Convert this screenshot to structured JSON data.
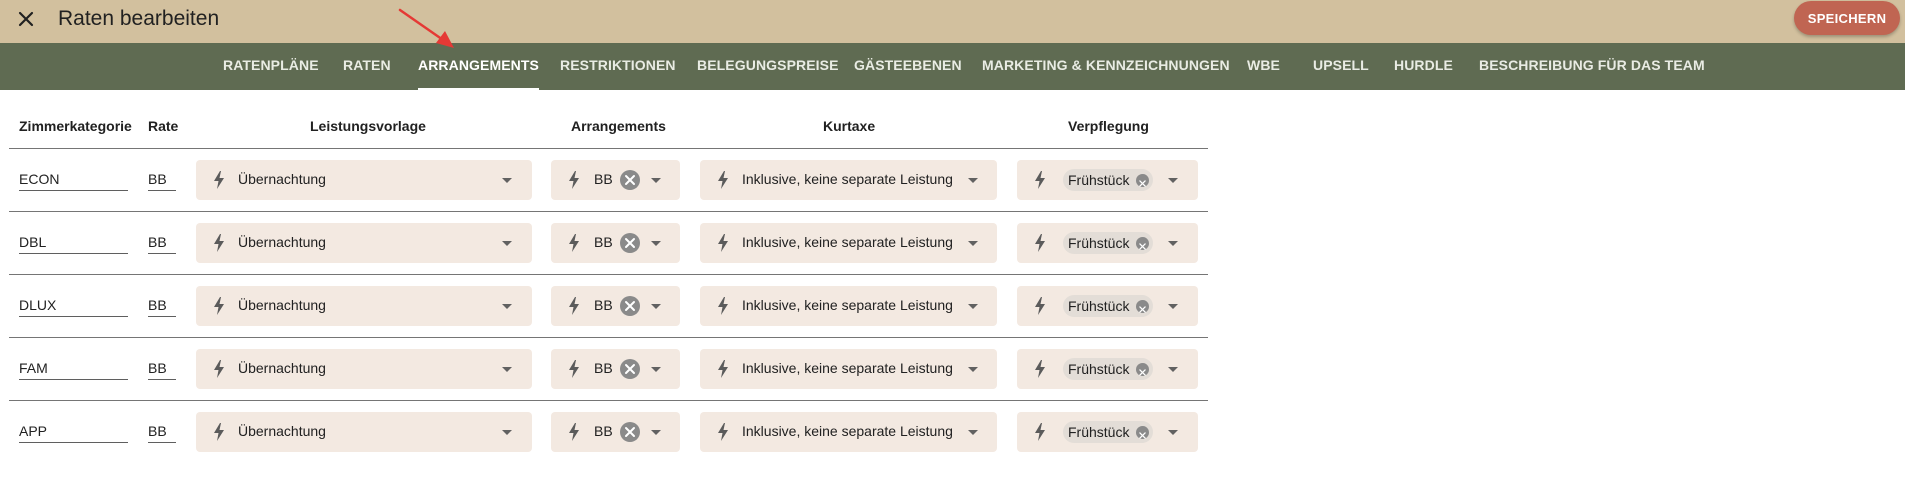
{
  "header": {
    "title": "Raten bearbeiten",
    "save_label": "SPEICHERN"
  },
  "tabs": [
    {
      "label": "RATENPLÄNE",
      "active": false
    },
    {
      "label": "RATEN",
      "active": false
    },
    {
      "label": "ARRANGEMENTS",
      "active": true
    },
    {
      "label": "RESTRIKTIONEN",
      "active": false
    },
    {
      "label": "BELEGUNGSPREISE",
      "active": false
    },
    {
      "label": "GÄSTEEBENEN",
      "active": false
    },
    {
      "label": "MARKETING & KENNZEICHNUNGEN",
      "active": false
    },
    {
      "label": "WBE",
      "active": false
    },
    {
      "label": "UPSELL",
      "active": false
    },
    {
      "label": "HURDLE",
      "active": false
    },
    {
      "label": "BESCHREIBUNG FÜR DAS TEAM",
      "active": false
    }
  ],
  "columns": {
    "room_category": "Zimmerkategorie",
    "rate": "Rate",
    "service_template": "Leistungsvorlage",
    "arrangements": "Arrangements",
    "tourist_tax": "Kurtaxe",
    "catering": "Verpflegung"
  },
  "rows": [
    {
      "room_category": "ECON",
      "rate": "BB",
      "service_template": "Übernachtung",
      "arrangement": "BB",
      "tourist_tax": "Inklusive, keine separate Leistung",
      "catering": "Frühstück"
    },
    {
      "room_category": "DBL",
      "rate": "BB",
      "service_template": "Übernachtung",
      "arrangement": "BB",
      "tourist_tax": "Inklusive, keine separate Leistung",
      "catering": "Frühstück"
    },
    {
      "room_category": "DLUX",
      "rate": "BB",
      "service_template": "Übernachtung",
      "arrangement": "BB",
      "tourist_tax": "Inklusive, keine separate Leistung",
      "catering": "Frühstück"
    },
    {
      "room_category": "FAM",
      "rate": "BB",
      "service_template": "Übernachtung",
      "arrangement": "BB",
      "tourist_tax": "Inklusive, keine separate Leistung",
      "catering": "Frühstück"
    },
    {
      "room_category": "APP",
      "rate": "BB",
      "service_template": "Übernachtung",
      "arrangement": "BB",
      "tourist_tax": "Inklusive, keine separate Leistung",
      "catering": "Frühstück"
    }
  ],
  "icons": {
    "close": "close-icon",
    "bolt": "bolt-icon",
    "clear": "clear-circle-icon",
    "dropdown": "chevron-down-icon",
    "annotation": "arrow-annotation-icon"
  },
  "colors": {
    "topbar": "#d2c09e",
    "navbar": "#5f6b52",
    "save_button": "#c06552",
    "select_bg": "#f3e9e1",
    "annotation_arrow": "#e53935"
  }
}
